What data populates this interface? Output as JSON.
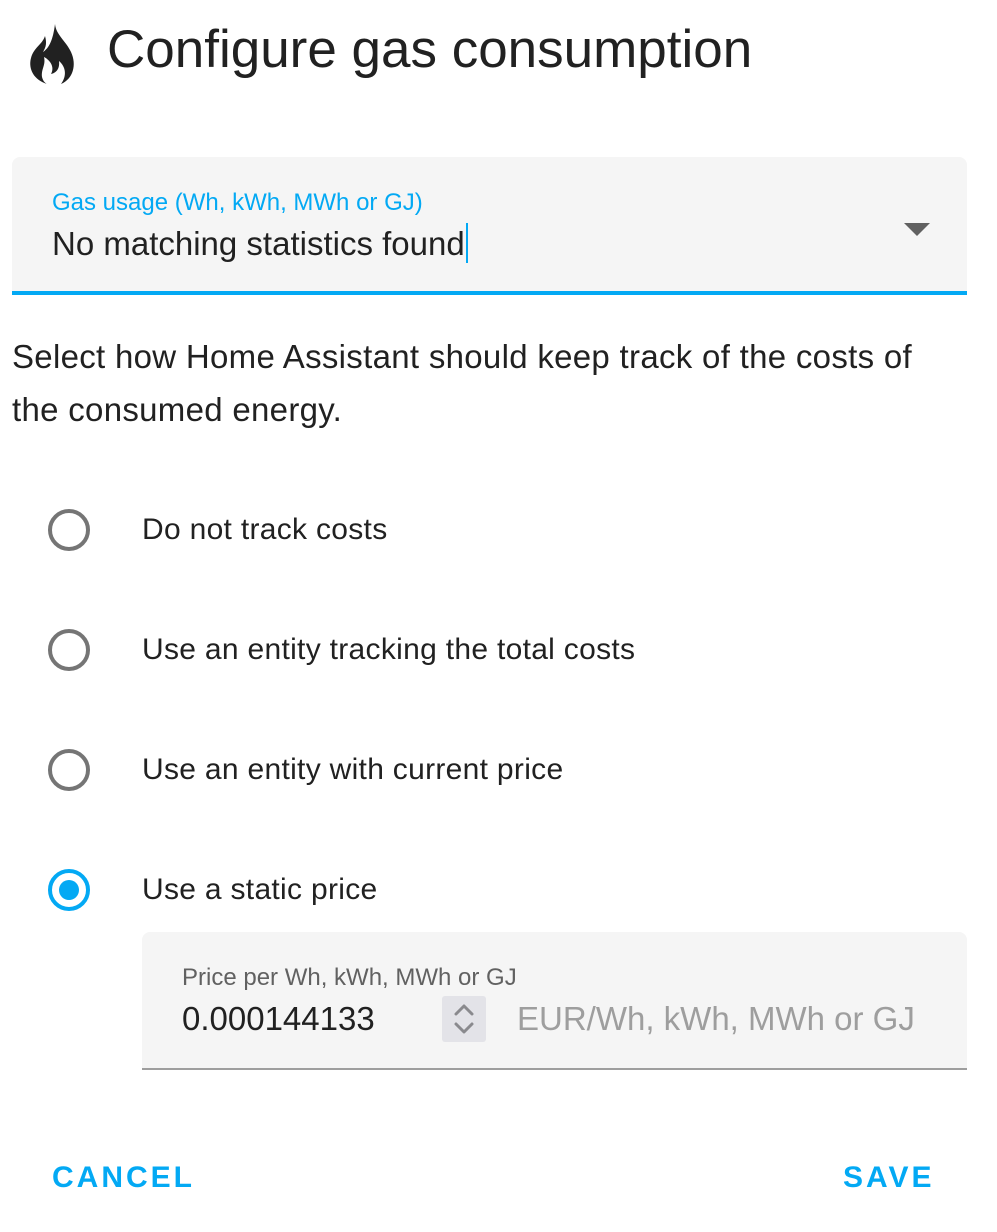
{
  "dialog": {
    "title": "Configure gas consumption",
    "icon": "fire-icon"
  },
  "usage_field": {
    "label": "Gas usage (Wh, kWh, MWh or GJ)",
    "value": "No matching statistics found",
    "focused": true
  },
  "description": "Select how Home Assistant should keep track of the costs of the consumed energy.",
  "cost_options": [
    {
      "label": "Do not track costs",
      "checked": false
    },
    {
      "label": "Use an entity tracking the total costs",
      "checked": false
    },
    {
      "label": "Use an entity with current price",
      "checked": false
    },
    {
      "label": "Use a static price",
      "checked": true
    }
  ],
  "price_field": {
    "label": "Price per Wh, kWh, MWh or GJ",
    "value": "0.000144133",
    "suffix": "EUR/Wh, kWh, MWh or GJ"
  },
  "actions": {
    "cancel_label": "CANCEL",
    "save_label": "SAVE"
  },
  "colors": {
    "accent": "#03a9f4",
    "text": "#212121",
    "field_background": "#f5f5f5",
    "radio_unchecked": "#757575"
  }
}
